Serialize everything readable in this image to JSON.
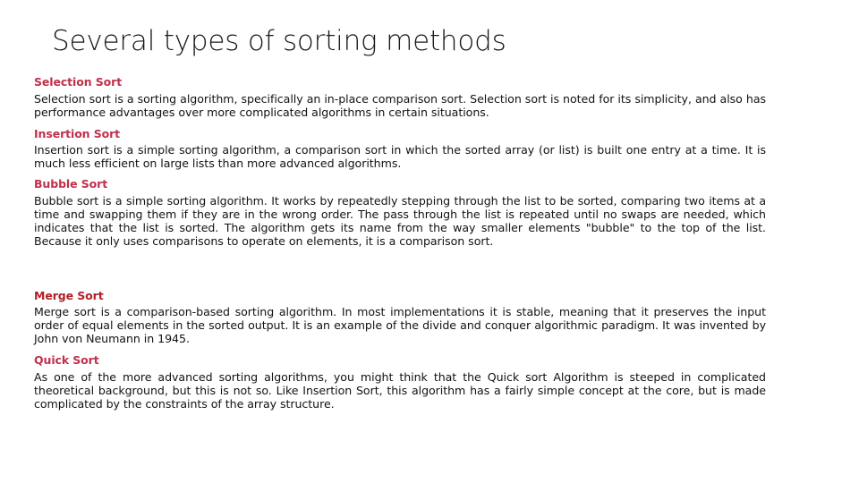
{
  "slide": {
    "title": "Several types of sorting methods",
    "sections": [
      {
        "heading": "Selection Sort",
        "body": "Selection sort is a sorting algorithm, specifically an in-place comparison sort. Selection sort is noted for its simplicity, and also has performance advantages over more complicated algorithms in certain situations."
      },
      {
        "heading": "Insertion Sort",
        "body": "Insertion sort is a simple sorting algorithm, a comparison sort in which the sorted array (or list) is built one entry at a time. It is much less efficient on large lists than more advanced algorithms."
      },
      {
        "heading": "Bubble Sort",
        "body": "Bubble sort is a simple sorting algorithm. It works by repeatedly stepping through the list to be sorted, comparing two items at a time and swapping them if they are in the wrong order. The pass through the list is repeated until no swaps are needed, which indicates that the list is sorted. The algorithm gets its name from the way smaller elements \"bubble\" to the top of the list. Because it only uses comparisons to operate on elements, it is a comparison sort."
      },
      {
        "heading": "Merge Sort",
        "body": "Merge sort is a comparison-based sorting algorithm. In most implementations it is stable, meaning that it preserves the input order of equal elements in the sorted output. It is an example of the divide and conquer algorithmic paradigm. It was invented by John von Neumann in 1945."
      },
      {
        "heading": "Quick Sort",
        "body": "As one of the more advanced sorting algorithms, you might think that the Quick sort Algorithm is steeped in complicated theoretical background, but this is not so. Like Insertion Sort, this algorithm has a fairly simple concept at the core, but is made complicated by the constraints of the array structure."
      }
    ]
  },
  "colors": {
    "background": "#ffffff",
    "title_text": "#1a1a1a",
    "heading_red": "#C0304A",
    "heading_red_dark": "#B22026",
    "body_text": "#121212"
  }
}
